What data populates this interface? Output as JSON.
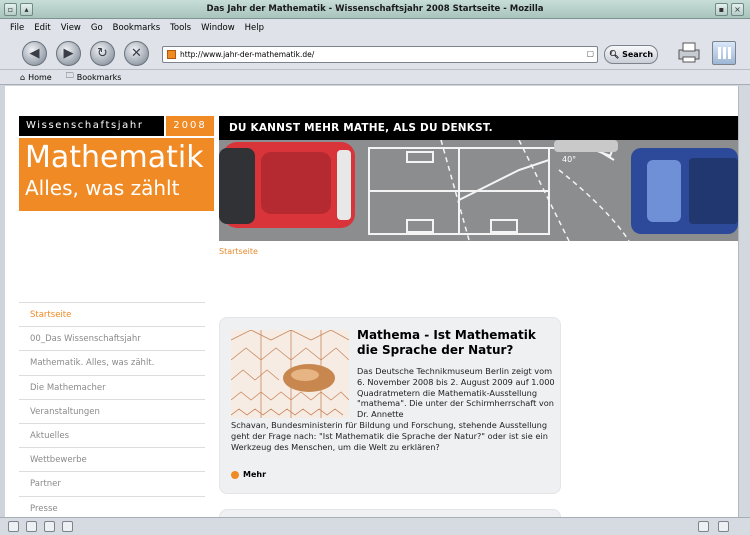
{
  "window": {
    "title": "Das Jahr der Mathematik - Wissenschaftsjahr 2008 Startseite - Mozilla"
  },
  "menu": [
    "File",
    "Edit",
    "View",
    "Go",
    "Bookmarks",
    "Tools",
    "Window",
    "Help"
  ],
  "nav": {
    "url": "http://www.jahr-der-mathematik.de/",
    "search_label": "Search"
  },
  "personal_toolbar": {
    "home": "Home",
    "bookmarks": "Bookmarks"
  },
  "site": {
    "badge_text": "Wissenschaftsjahr",
    "badge_year": "2008",
    "logo_line1": "Mathematik",
    "logo_line2": "Alles, was zählt",
    "slogan": "DU KANNST MEHR MATHE, ALS DU DENKST.",
    "angle_label": "40°",
    "breadcrumb": "Startseite"
  },
  "left_nav": [
    "Startseite",
    "00_Das Wissenschaftsjahr",
    "Mathematik. Alles, was zählt.",
    "Die Mathemacher",
    "Veranstaltungen",
    "Aktuelles",
    "Wettbewerbe",
    "Partner",
    "Presse"
  ],
  "teaser": {
    "title": "Mathema - Ist Mathematik die Sprache der Natur?",
    "body_right": "Das Deutsche Technikmuseum Berlin zeigt vom 6. November 2008 bis 2. August 2009 auf 1.000 Quadratmetern die Mathematik-Ausstellung \"mathema\". Die unter der Schirmherrschaft von Dr. Annette",
    "body_full": "Schavan, Bundesministerin für Bildung und Forschung, stehende Ausstellung geht der Frage nach: \"Ist Mathematik die Sprache der Natur?\" oder ist sie ein Werkzeug des Menschen, um die Welt zu erklären?",
    "more_label": "Mehr"
  }
}
